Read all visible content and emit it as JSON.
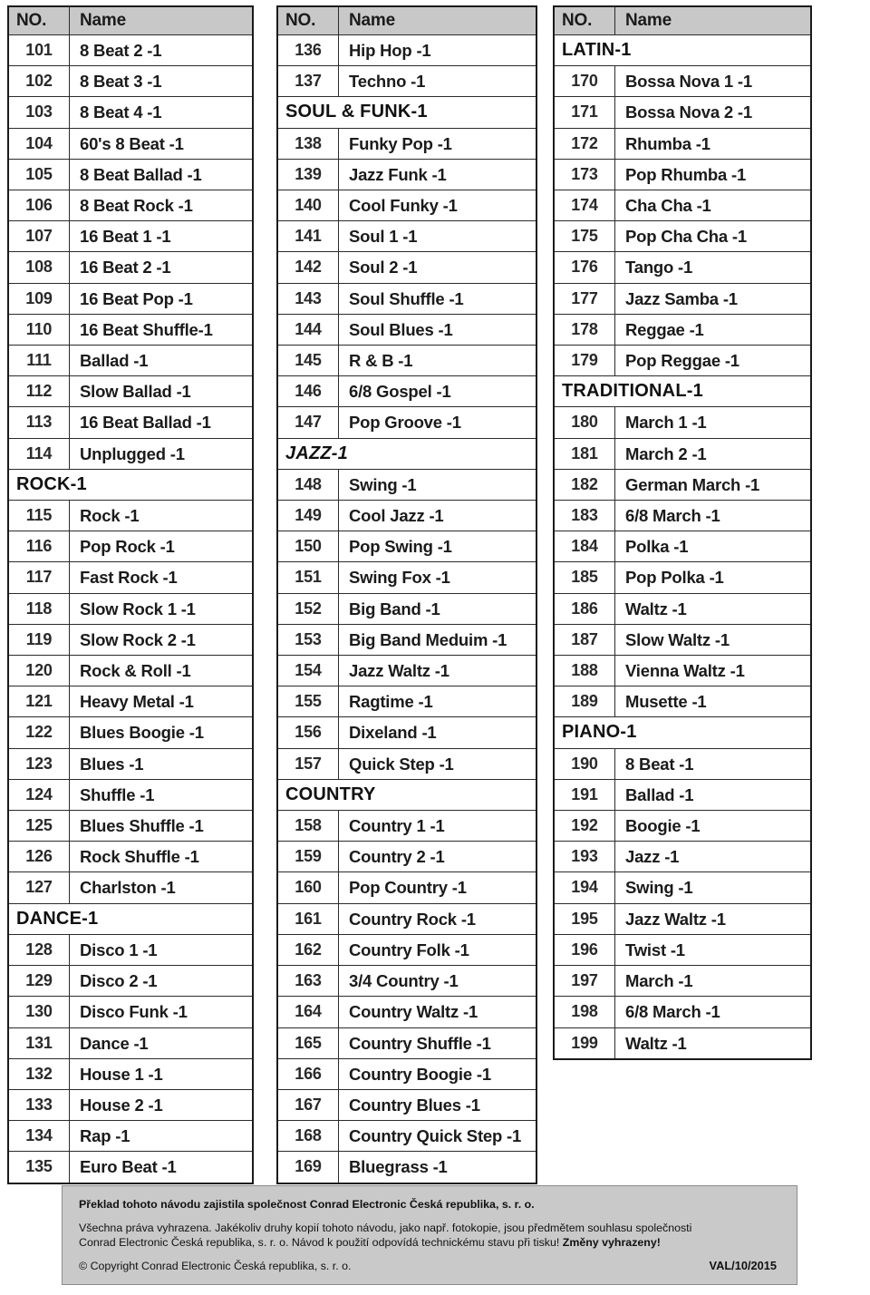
{
  "table_headers": {
    "no": "NO.",
    "name": "Name"
  },
  "columns": [
    {
      "id": "column-1",
      "rows": [
        {
          "type": "item",
          "no": "101",
          "name": "8 Beat 2 -1"
        },
        {
          "type": "item",
          "no": "102",
          "name": "8 Beat 3 -1"
        },
        {
          "type": "item",
          "no": "103",
          "name": "8 Beat 4 -1"
        },
        {
          "type": "item",
          "no": "104",
          "name": "60's 8 Beat -1"
        },
        {
          "type": "item",
          "no": "105",
          "name": "8 Beat Ballad -1"
        },
        {
          "type": "item",
          "no": "106",
          "name": "8 Beat Rock -1"
        },
        {
          "type": "item",
          "no": "107",
          "name": "16 Beat 1 -1"
        },
        {
          "type": "item",
          "no": "108",
          "name": "16 Beat 2 -1"
        },
        {
          "type": "item",
          "no": "109",
          "name": "16 Beat Pop -1"
        },
        {
          "type": "item",
          "no": "110",
          "name": "16 Beat Shuffle-1"
        },
        {
          "type": "item",
          "no": "111",
          "name": "Ballad -1"
        },
        {
          "type": "item",
          "no": "112",
          "name": "Slow Ballad -1"
        },
        {
          "type": "item",
          "no": "113",
          "name": "16 Beat Ballad -1"
        },
        {
          "type": "item",
          "no": "114",
          "name": "Unplugged -1"
        },
        {
          "type": "category",
          "label": "ROCK-1"
        },
        {
          "type": "item",
          "no": "115",
          "name": "Rock -1"
        },
        {
          "type": "item",
          "no": "116",
          "name": "Pop Rock -1"
        },
        {
          "type": "item",
          "no": "117",
          "name": "Fast Rock -1"
        },
        {
          "type": "item",
          "no": "118",
          "name": "Slow Rock 1 -1"
        },
        {
          "type": "item",
          "no": "119",
          "name": "Slow Rock 2 -1"
        },
        {
          "type": "item",
          "no": "120",
          "name": "Rock & Roll -1"
        },
        {
          "type": "item",
          "no": "121",
          "name": "Heavy Metal -1"
        },
        {
          "type": "item",
          "no": "122",
          "name": "Blues Boogie -1"
        },
        {
          "type": "item",
          "no": "123",
          "name": "Blues -1"
        },
        {
          "type": "item",
          "no": "124",
          "name": "Shuffle -1"
        },
        {
          "type": "item",
          "no": "125",
          "name": "Blues Shuffle -1"
        },
        {
          "type": "item",
          "no": "126",
          "name": "Rock Shuffle -1"
        },
        {
          "type": "item",
          "no": "127",
          "name": "Charlston -1"
        },
        {
          "type": "category",
          "label": "DANCE-1"
        },
        {
          "type": "item",
          "no": "128",
          "name": "Disco 1 -1"
        },
        {
          "type": "item",
          "no": "129",
          "name": "Disco 2 -1"
        },
        {
          "type": "item",
          "no": "130",
          "name": "Disco Funk -1"
        },
        {
          "type": "item",
          "no": "131",
          "name": "Dance -1"
        },
        {
          "type": "item",
          "no": "132",
          "name": "House 1 -1"
        },
        {
          "type": "item",
          "no": "133",
          "name": "House 2 -1"
        },
        {
          "type": "item",
          "no": "134",
          "name": "Rap -1"
        },
        {
          "type": "item",
          "no": "135",
          "name": "Euro Beat -1"
        }
      ]
    },
    {
      "id": "column-2",
      "rows": [
        {
          "type": "item",
          "no": "136",
          "name": "Hip Hop -1"
        },
        {
          "type": "item",
          "no": "137",
          "name": "Techno -1"
        },
        {
          "type": "category",
          "label": "SOUL & FUNK-1"
        },
        {
          "type": "item",
          "no": "138",
          "name": "Funky Pop -1"
        },
        {
          "type": "item",
          "no": "139",
          "name": "Jazz Funk -1"
        },
        {
          "type": "item",
          "no": "140",
          "name": "Cool Funky -1"
        },
        {
          "type": "item",
          "no": "141",
          "name": "Soul 1 -1"
        },
        {
          "type": "item",
          "no": "142",
          "name": "Soul 2 -1"
        },
        {
          "type": "item",
          "no": "143",
          "name": "Soul Shuffle -1"
        },
        {
          "type": "item",
          "no": "144",
          "name": "Soul Blues -1"
        },
        {
          "type": "item",
          "no": "145",
          "name": "R & B -1"
        },
        {
          "type": "item",
          "no": "146",
          "name": "6/8 Gospel -1"
        },
        {
          "type": "item",
          "no": "147",
          "name": "Pop Groove -1"
        },
        {
          "type": "category",
          "label": "JAZZ-1",
          "italic": true
        },
        {
          "type": "item",
          "no": "148",
          "name": "Swing -1"
        },
        {
          "type": "item",
          "no": "149",
          "name": "Cool Jazz -1"
        },
        {
          "type": "item",
          "no": "150",
          "name": "Pop Swing -1"
        },
        {
          "type": "item",
          "no": "151",
          "name": "Swing Fox -1"
        },
        {
          "type": "item",
          "no": "152",
          "name": "Big Band -1"
        },
        {
          "type": "item",
          "no": "153",
          "name": "Big Band Meduim -1"
        },
        {
          "type": "item",
          "no": "154",
          "name": "Jazz Waltz -1"
        },
        {
          "type": "item",
          "no": "155",
          "name": "Ragtime -1"
        },
        {
          "type": "item",
          "no": "156",
          "name": "Dixeland -1"
        },
        {
          "type": "item",
          "no": "157",
          "name": "Quick Step -1"
        },
        {
          "type": "category",
          "label": "COUNTRY"
        },
        {
          "type": "item",
          "no": "158",
          "name": "Country 1 -1"
        },
        {
          "type": "item",
          "no": "159",
          "name": "Country 2 -1"
        },
        {
          "type": "item",
          "no": "160",
          "name": "Pop Country -1"
        },
        {
          "type": "item",
          "no": "161",
          "name": "Country Rock -1"
        },
        {
          "type": "item",
          "no": "162",
          "name": "Country Folk -1"
        },
        {
          "type": "item",
          "no": "163",
          "name": "3/4 Country -1"
        },
        {
          "type": "item",
          "no": "164",
          "name": "Country Waltz -1"
        },
        {
          "type": "item",
          "no": "165",
          "name": "Country Shuffle -1"
        },
        {
          "type": "item",
          "no": "166",
          "name": "Country Boogie -1"
        },
        {
          "type": "item",
          "no": "167",
          "name": "Country Blues -1"
        },
        {
          "type": "item",
          "no": "168",
          "name": "Country Quick Step -1"
        },
        {
          "type": "item",
          "no": "169",
          "name": "Bluegrass -1"
        }
      ]
    },
    {
      "id": "column-3",
      "rows": [
        {
          "type": "category",
          "label": "LATIN-1"
        },
        {
          "type": "item",
          "no": "170",
          "name": "Bossa Nova 1 -1"
        },
        {
          "type": "item",
          "no": "171",
          "name": "Bossa Nova 2 -1"
        },
        {
          "type": "item",
          "no": "172",
          "name": "Rhumba -1"
        },
        {
          "type": "item",
          "no": "173",
          "name": "Pop Rhumba -1"
        },
        {
          "type": "item",
          "no": "174",
          "name": "Cha Cha -1"
        },
        {
          "type": "item",
          "no": "175",
          "name": "Pop Cha Cha -1"
        },
        {
          "type": "item",
          "no": "176",
          "name": "Tango -1"
        },
        {
          "type": "item",
          "no": "177",
          "name": "Jazz Samba -1"
        },
        {
          "type": "item",
          "no": "178",
          "name": "Reggae -1"
        },
        {
          "type": "item",
          "no": "179",
          "name": "Pop Reggae -1"
        },
        {
          "type": "category",
          "label": "TRADITIONAL-1"
        },
        {
          "type": "item",
          "no": "180",
          "name": "March 1 -1"
        },
        {
          "type": "item",
          "no": "181",
          "name": "March 2 -1"
        },
        {
          "type": "item",
          "no": "182",
          "name": "German March -1"
        },
        {
          "type": "item",
          "no": "183",
          "name": "6/8 March -1"
        },
        {
          "type": "item",
          "no": "184",
          "name": "Polka -1"
        },
        {
          "type": "item",
          "no": "185",
          "name": "Pop Polka -1"
        },
        {
          "type": "item",
          "no": "186",
          "name": "Waltz -1"
        },
        {
          "type": "item",
          "no": "187",
          "name": "Slow Waltz -1"
        },
        {
          "type": "item",
          "no": "188",
          "name": "Vienna Waltz -1"
        },
        {
          "type": "item",
          "no": "189",
          "name": "Musette -1"
        },
        {
          "type": "category",
          "label": "PIANO-1"
        },
        {
          "type": "item",
          "no": "190",
          "name": "8 Beat -1"
        },
        {
          "type": "item",
          "no": "191",
          "name": "Ballad -1"
        },
        {
          "type": "item",
          "no": "192",
          "name": "Boogie -1"
        },
        {
          "type": "item",
          "no": "193",
          "name": "Jazz -1"
        },
        {
          "type": "item",
          "no": "194",
          "name": "Swing -1"
        },
        {
          "type": "item",
          "no": "195",
          "name": "Jazz Waltz -1"
        },
        {
          "type": "item",
          "no": "196",
          "name": "Twist -1"
        },
        {
          "type": "item",
          "no": "197",
          "name": "March -1"
        },
        {
          "type": "item",
          "no": "198",
          "name": "6/8 March -1"
        },
        {
          "type": "item",
          "no": "199",
          "name": "Waltz -1"
        }
      ]
    }
  ],
  "footer": {
    "title": "Překlad tohoto návodu zajistila společnost Conrad Electronic  Česká republika, s. r. o.",
    "body_line1": "Všechna práva vyhrazena. Jakékoliv druhy kopií tohoto návodu, jako např. fotokopie,  jsou předmětem souhlasu společnosti",
    "body_line2_plain": "Conrad Electronic Česká republika, s. r. o.  Návod k použití odpovídá technickému stavu při tisku! ",
    "body_line2_bold": "Změny vyhrazeny!",
    "copyright": "© Copyright Conrad Electronic Česká republika, s. r. o.",
    "version": "VAL/10/2015"
  },
  "colors": {
    "header_fill": "#c8c8c8",
    "footer_fill": "#c9c9c9",
    "border": "#2b2b2b",
    "text": "#1b1b1b"
  }
}
